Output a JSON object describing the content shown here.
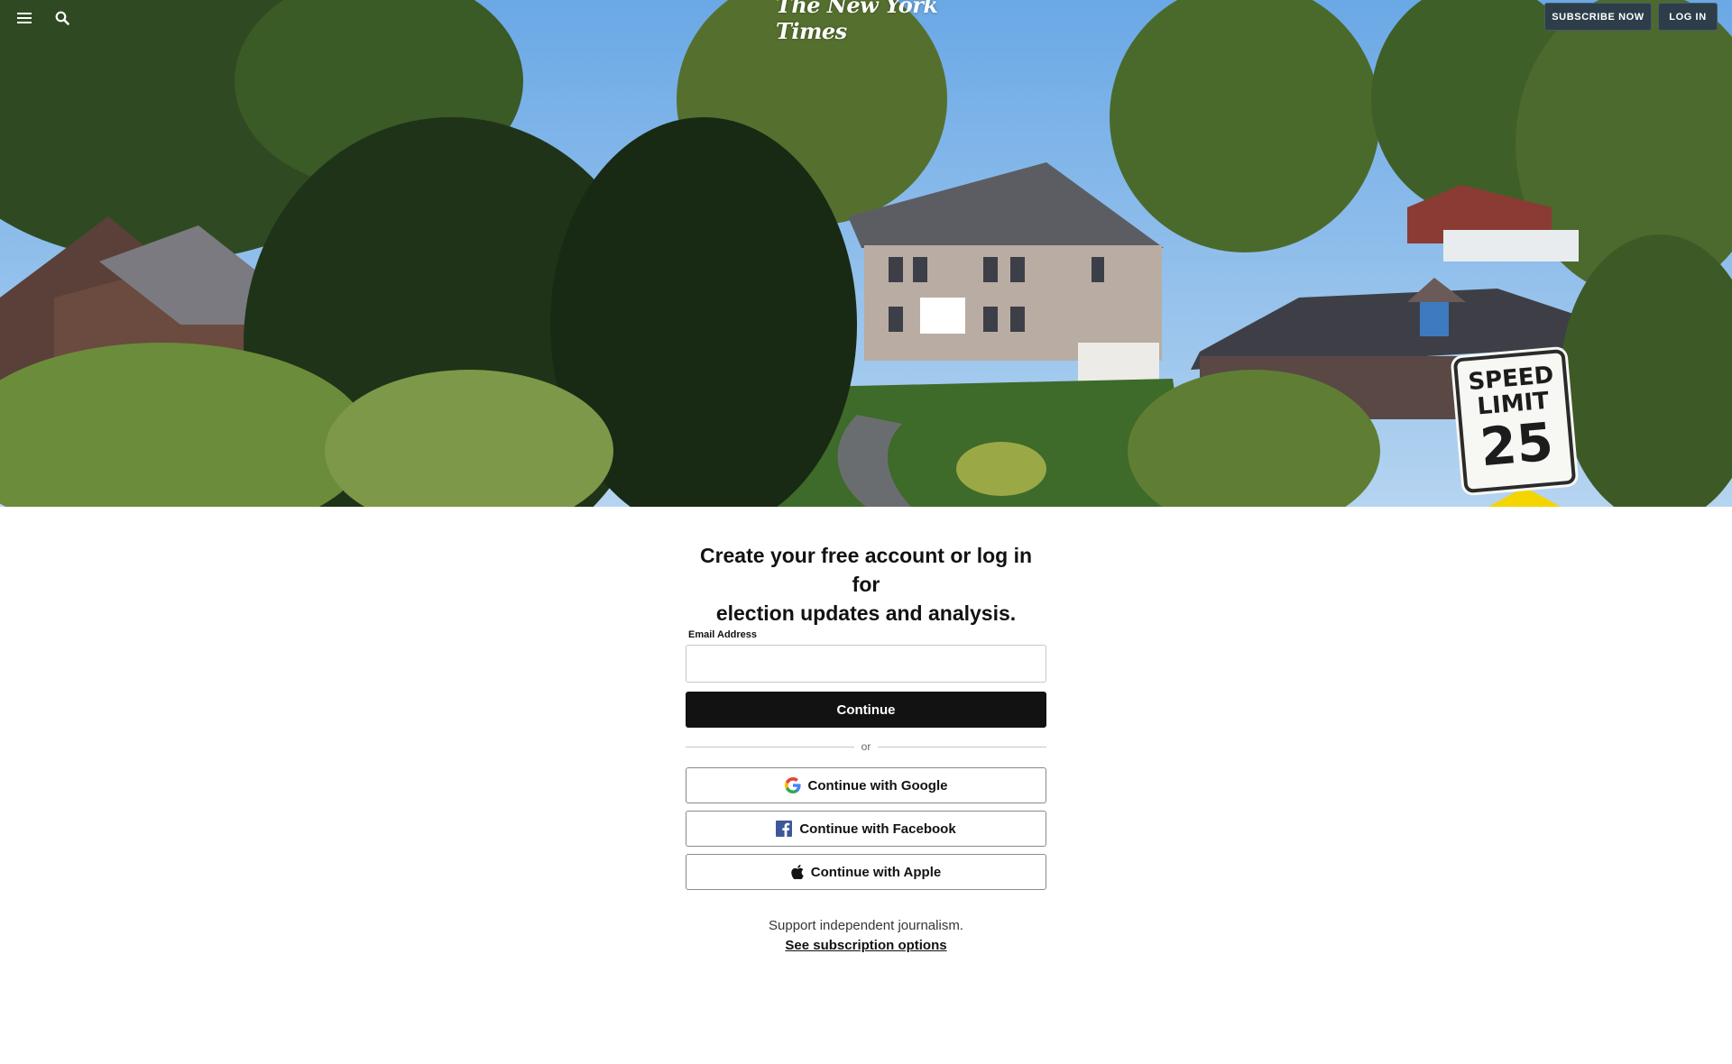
{
  "header": {
    "logo": "The New York Times",
    "menu_icon": "hamburger-menu-icon",
    "search_icon": "search-icon",
    "subscribe_label": "SUBSCRIBE NOW",
    "login_label": "LOG IN"
  },
  "hero": {
    "sign": {
      "line1": "SPEED",
      "line2": "LIMIT",
      "number": "25"
    }
  },
  "form": {
    "headline_line1": "Create your free account or log in for",
    "headline_line2": "election updates and analysis.",
    "email_label": "Email Address",
    "email_value": "",
    "continue_label": "Continue",
    "or_text": "or",
    "google_label": "Continue with Google",
    "facebook_label": "Continue with Facebook",
    "apple_label": "Continue with Apple",
    "support_text": "Support independent journalism.",
    "subscription_link": "See subscription options"
  },
  "colors": {
    "primary_button": "#121212",
    "header_button": "#2d3e4a",
    "facebook_blue": "#3b5998",
    "sign_yellow": "#f4d500"
  }
}
